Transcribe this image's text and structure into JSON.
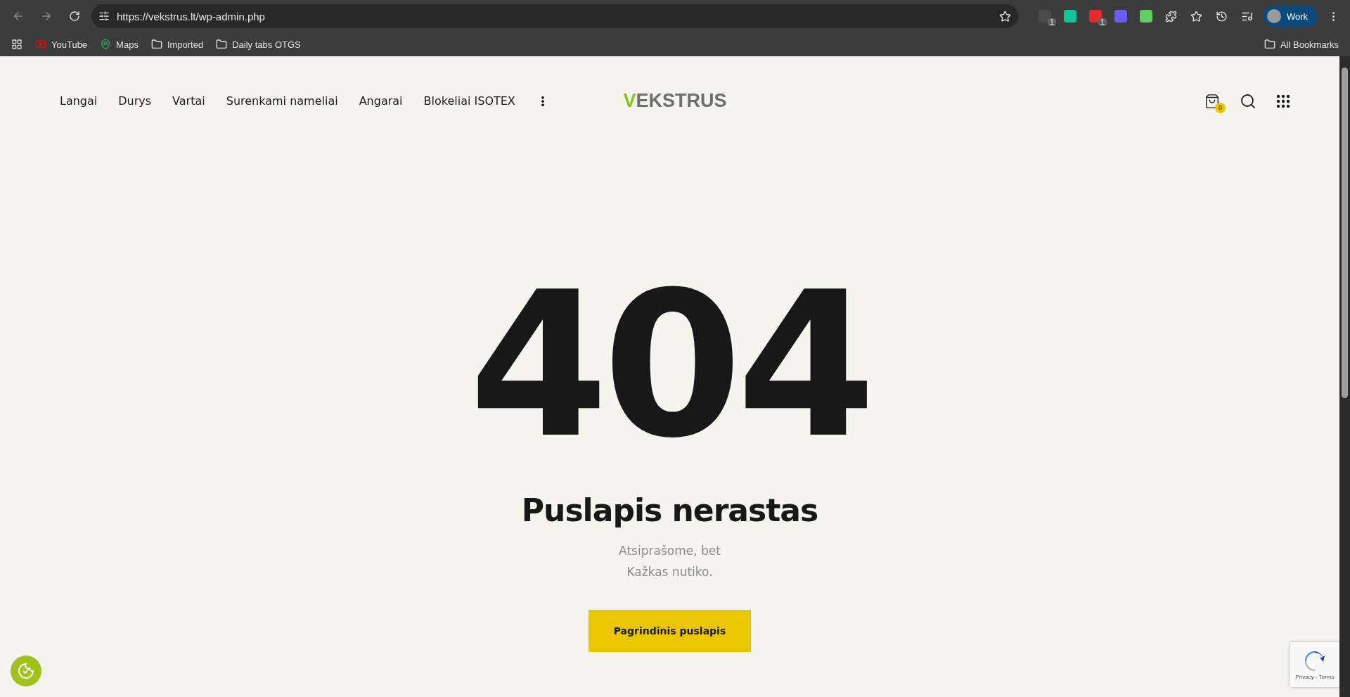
{
  "browser": {
    "url": "https://vekstrus.lt/wp-admin.php",
    "extension_badges": [
      "1",
      "1"
    ],
    "profile": "Work",
    "bookmarks": [
      {
        "label": "YouTube",
        "kind": "youtube"
      },
      {
        "label": "Maps",
        "kind": "maps"
      },
      {
        "label": "Imported",
        "kind": "folder"
      },
      {
        "label": "Daily tabs OTGS",
        "kind": "folder"
      }
    ],
    "all_bookmarks": "All Bookmarks"
  },
  "header": {
    "nav": [
      "Langai",
      "Durys",
      "Vartai",
      "Surenkami nameliai",
      "Angarai",
      "Blokeliai ISOTEX"
    ],
    "logo": "VEKSTRUS",
    "cart_count": "0"
  },
  "error": {
    "code": "404",
    "title": "Puslapis nerastas",
    "message": [
      "Atsiprašome, bet",
      "Kažkas nutiko."
    ],
    "button": "Pagrindinis puslapis"
  },
  "recaptcha": {
    "links": "Privacy - Terms"
  }
}
